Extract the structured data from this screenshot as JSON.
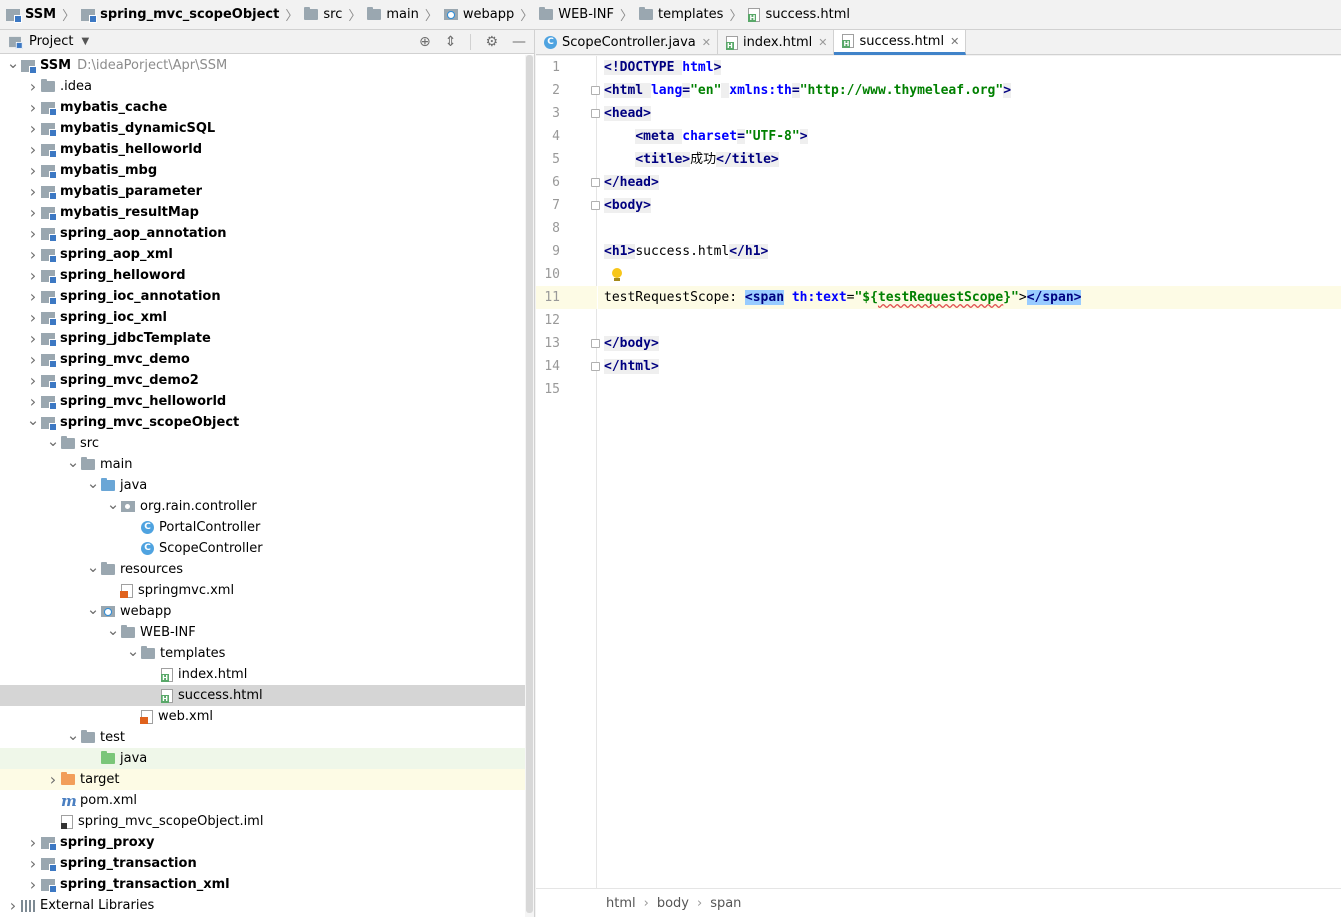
{
  "breadcrumb": [
    {
      "label": "SSM",
      "icon": "module-icon",
      "bold": true
    },
    {
      "label": "spring_mvc_scopeObject",
      "icon": "module-icon",
      "bold": true
    },
    {
      "label": "src",
      "icon": "folder-icon"
    },
    {
      "label": "main",
      "icon": "folder-icon"
    },
    {
      "label": "webapp",
      "icon": "web-folder-icon"
    },
    {
      "label": "WEB-INF",
      "icon": "folder-icon"
    },
    {
      "label": "templates",
      "icon": "folder-icon"
    },
    {
      "label": "success.html",
      "icon": "html-file-icon"
    }
  ],
  "project_panel": {
    "title": "Project"
  },
  "tree": [
    {
      "label": "SSM",
      "path": "D:\\ideaPorject\\Apr\\SSM",
      "icon": "module",
      "depth": 0,
      "arrow": "down",
      "bold": true
    },
    {
      "label": ".idea",
      "icon": "folder",
      "depth": 1,
      "arrow": "right"
    },
    {
      "label": "mybatis_cache",
      "icon": "module",
      "depth": 1,
      "arrow": "right",
      "bold": true
    },
    {
      "label": "mybatis_dynamicSQL",
      "icon": "module",
      "depth": 1,
      "arrow": "right",
      "bold": true
    },
    {
      "label": "mybatis_helloworld",
      "icon": "module",
      "depth": 1,
      "arrow": "right",
      "bold": true
    },
    {
      "label": "mybatis_mbg",
      "icon": "module",
      "depth": 1,
      "arrow": "right",
      "bold": true
    },
    {
      "label": "mybatis_parameter",
      "icon": "module",
      "depth": 1,
      "arrow": "right",
      "bold": true
    },
    {
      "label": "mybatis_resultMap",
      "icon": "module",
      "depth": 1,
      "arrow": "right",
      "bold": true
    },
    {
      "label": "spring_aop_annotation",
      "icon": "module",
      "depth": 1,
      "arrow": "right",
      "bold": true
    },
    {
      "label": "spring_aop_xml",
      "icon": "module",
      "depth": 1,
      "arrow": "right",
      "bold": true
    },
    {
      "label": "spring_helloword",
      "icon": "module",
      "depth": 1,
      "arrow": "right",
      "bold": true
    },
    {
      "label": "spring_ioc_annotation",
      "icon": "module",
      "depth": 1,
      "arrow": "right",
      "bold": true
    },
    {
      "label": "spring_ioc_xml",
      "icon": "module",
      "depth": 1,
      "arrow": "right",
      "bold": true
    },
    {
      "label": "spring_jdbcTemplate",
      "icon": "module",
      "depth": 1,
      "arrow": "right",
      "bold": true
    },
    {
      "label": "spring_mvc_demo",
      "icon": "module",
      "depth": 1,
      "arrow": "right",
      "bold": true
    },
    {
      "label": "spring_mvc_demo2",
      "icon": "module",
      "depth": 1,
      "arrow": "right",
      "bold": true
    },
    {
      "label": "spring_mvc_helloworld",
      "icon": "module",
      "depth": 1,
      "arrow": "right",
      "bold": true
    },
    {
      "label": "spring_mvc_scopeObject",
      "icon": "module",
      "depth": 1,
      "arrow": "down",
      "bold": true
    },
    {
      "label": "src",
      "icon": "folder",
      "depth": 2,
      "arrow": "down"
    },
    {
      "label": "main",
      "icon": "folder",
      "depth": 3,
      "arrow": "down"
    },
    {
      "label": "java",
      "icon": "folder-blue",
      "depth": 4,
      "arrow": "down"
    },
    {
      "label": "org.rain.controller",
      "icon": "package",
      "depth": 5,
      "arrow": "down"
    },
    {
      "label": "PortalController",
      "icon": "class",
      "depth": 6,
      "arrow": ""
    },
    {
      "label": "ScopeController",
      "icon": "class",
      "depth": 6,
      "arrow": ""
    },
    {
      "label": "resources",
      "icon": "folder-res",
      "depth": 4,
      "arrow": "down"
    },
    {
      "label": "springmvc.xml",
      "icon": "xml",
      "depth": 5,
      "arrow": ""
    },
    {
      "label": "webapp",
      "icon": "web-folder",
      "depth": 4,
      "arrow": "down"
    },
    {
      "label": "WEB-INF",
      "icon": "folder",
      "depth": 5,
      "arrow": "down"
    },
    {
      "label": "templates",
      "icon": "folder",
      "depth": 6,
      "arrow": "down"
    },
    {
      "label": "index.html",
      "icon": "html",
      "depth": 7,
      "arrow": ""
    },
    {
      "label": "success.html",
      "icon": "html",
      "depth": 7,
      "arrow": "",
      "selected": true
    },
    {
      "label": "web.xml",
      "icon": "xml",
      "depth": 6,
      "arrow": ""
    },
    {
      "label": "test",
      "icon": "folder",
      "depth": 3,
      "arrow": "down"
    },
    {
      "label": "java",
      "icon": "folder-green",
      "depth": 4,
      "arrow": "",
      "bg": "test"
    },
    {
      "label": "target",
      "icon": "folder-orange",
      "depth": 2,
      "arrow": "right",
      "bg": "excluded"
    },
    {
      "label": "pom.xml",
      "icon": "maven",
      "depth": 2,
      "arrow": ""
    },
    {
      "label": "spring_mvc_scopeObject.iml",
      "icon": "iml",
      "depth": 2,
      "arrow": ""
    },
    {
      "label": "spring_proxy",
      "icon": "module",
      "depth": 1,
      "arrow": "right",
      "bold": true
    },
    {
      "label": "spring_transaction",
      "icon": "module",
      "depth": 1,
      "arrow": "right",
      "bold": true
    },
    {
      "label": "spring_transaction_xml",
      "icon": "module",
      "depth": 1,
      "arrow": "right",
      "bold": true
    },
    {
      "label": "External Libraries",
      "icon": "library",
      "depth": 0,
      "arrow": "right"
    }
  ],
  "editor_tabs": [
    {
      "label": "ScopeController.java",
      "icon": "class",
      "active": false
    },
    {
      "label": "index.html",
      "icon": "html",
      "active": false
    },
    {
      "label": "success.html",
      "icon": "html",
      "active": true
    }
  ],
  "code_lines": [
    {
      "n": "1",
      "tokens": [
        [
          "tg",
          "<!DOCTYPE "
        ],
        [
          "at",
          "html"
        ],
        [
          "tg",
          ">"
        ]
      ]
    },
    {
      "n": "2",
      "tokens": [
        [
          "tg",
          "<html "
        ],
        [
          "at",
          "lang"
        ],
        [
          "tg",
          "="
        ],
        [
          "sv",
          "\"en\""
        ],
        [
          "tg",
          " "
        ],
        [
          "at",
          "xmlns:th"
        ],
        [
          "tg",
          "="
        ],
        [
          "sv",
          "\"http://www.thymeleaf.org\""
        ],
        [
          "tg",
          ">"
        ]
      ]
    },
    {
      "n": "3",
      "tokens": [
        [
          "tg",
          "<head>"
        ]
      ]
    },
    {
      "n": "4",
      "tokens": [
        [
          "pl",
          "    "
        ],
        [
          "tg",
          "<meta "
        ],
        [
          "at",
          "charset"
        ],
        [
          "tg",
          "="
        ],
        [
          "sv",
          "\"UTF-8\""
        ],
        [
          "tg",
          ">"
        ]
      ]
    },
    {
      "n": "5",
      "tokens": [
        [
          "pl",
          "    "
        ],
        [
          "tg",
          "<title>"
        ],
        [
          "pl",
          "成功"
        ],
        [
          "tg",
          "</title>"
        ]
      ]
    },
    {
      "n": "6",
      "tokens": [
        [
          "tg",
          "</head>"
        ]
      ]
    },
    {
      "n": "7",
      "tokens": [
        [
          "tg",
          "<body>"
        ]
      ]
    },
    {
      "n": "8",
      "tokens": []
    },
    {
      "n": "9",
      "tokens": [
        [
          "tg",
          "<h1>"
        ],
        [
          "pl",
          "success.html"
        ],
        [
          "tg",
          "</h1>"
        ]
      ]
    },
    {
      "n": "10",
      "tokens": []
    },
    {
      "n": "11",
      "tokens": [
        [
          "pl",
          "testRequestScope: "
        ],
        [
          "tg-hl",
          "<span"
        ],
        [
          "pl",
          " "
        ],
        [
          "at",
          "th:text"
        ],
        [
          "pl",
          "="
        ],
        [
          "sv",
          "\"${"
        ],
        [
          "sv sq",
          "testRequestScope"
        ],
        [
          "sv",
          "}\""
        ],
        [
          "pl",
          ">"
        ],
        [
          "tg-hl",
          "</span>"
        ]
      ],
      "current": true
    },
    {
      "n": "12",
      "tokens": []
    },
    {
      "n": "13",
      "tokens": [
        [
          "tg",
          "</body>"
        ]
      ]
    },
    {
      "n": "14",
      "tokens": [
        [
          "tg",
          "</html>"
        ]
      ]
    },
    {
      "n": "15",
      "tokens": []
    }
  ],
  "status_crumbs": [
    "html",
    "body",
    "span"
  ],
  "colors": {
    "selection": "#d5d5d5",
    "active_tab_underline": "#4083c9",
    "tag": "#000080",
    "attribute": "#0000ff",
    "string": "#008000",
    "current_line": "#fdfbe5"
  }
}
